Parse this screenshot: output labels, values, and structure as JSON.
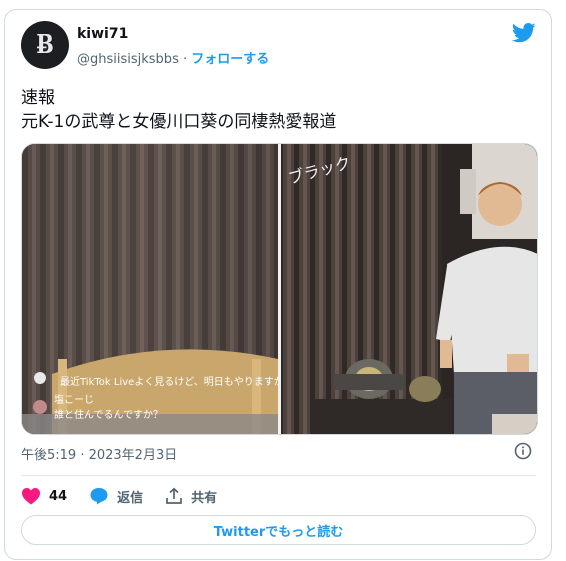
{
  "author": {
    "avatar_glyph": "Ƀ",
    "name": "kiwi71",
    "handle": "@ghsiisisjksbbs",
    "separator": "·",
    "follow_label": "フォローする"
  },
  "tweet": {
    "line1": "速報",
    "line2": "元K-1の武尊と女優川口葵の同棲熱愛報道"
  },
  "media": {
    "overlay_lines": [
      "最近TikTok Liveよく見るけど、明日もやりますか",
      "塩こーじ",
      "誰と住んでるんですか？"
    ],
    "watermark": "ブラック"
  },
  "timestamp": "午後5:19 · 2023年2月3日",
  "actions": {
    "like_count": "44",
    "reply_label": "返信",
    "share_label": "共有"
  },
  "read_more_label": "Twitterでもっと読む",
  "colors": {
    "accent": "#1d9bf0",
    "like": "#f91880",
    "text": "#0f1419",
    "secondary": "#536471",
    "border": "#cfd9de"
  },
  "icons": [
    "twitter-bird-icon",
    "info-icon",
    "heart-icon",
    "reply-bubble-icon",
    "share-icon"
  ]
}
